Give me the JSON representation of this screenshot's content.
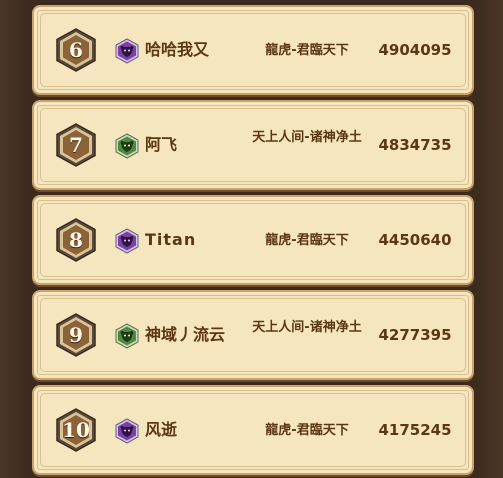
{
  "leaderboard": {
    "rows": [
      {
        "rank": "6",
        "icon": "purple-bull-icon",
        "name": "哈哈我又",
        "server": "龍虎-君臨天下",
        "score": "4904095"
      },
      {
        "rank": "7",
        "icon": "green-bull-icon",
        "name": "阿飞",
        "server": "天上人间-诸神净土",
        "score": "4834735"
      },
      {
        "rank": "8",
        "icon": "purple-bull-icon",
        "name": "Titan",
        "server": "龍虎-君臨天下",
        "score": "4450640"
      },
      {
        "rank": "9",
        "icon": "green-bull-icon",
        "name": "神域丿流云",
        "server": "天上人间-诸神净土",
        "score": "4277395"
      },
      {
        "rank": "10",
        "icon": "purple-bull-icon",
        "name": "风逝",
        "server": "龍虎-君臨天下",
        "score": "4175245"
      }
    ]
  },
  "colors": {
    "row_background": "#f6e6bf",
    "row_border": "#c6a46b",
    "text": "#5b3714",
    "rank_badge": "#8c6239",
    "purple_icon": "#7b3fa6",
    "green_icon": "#4f8a3a"
  }
}
